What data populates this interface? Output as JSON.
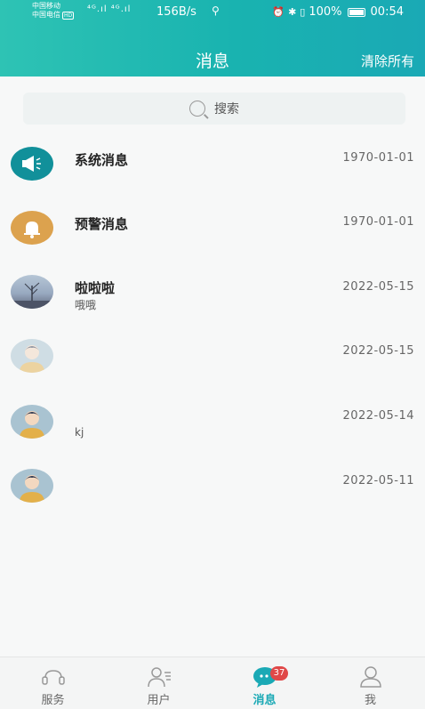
{
  "status_bar": {
    "carrier_1": "中国移动",
    "carrier_2": "中国电信",
    "hd": "HD",
    "signals": "⁴ᴳ.ıl ⁴ᴳ.ıl",
    "net_speed": "156B/s",
    "battery": "100%",
    "time": "00:54"
  },
  "header": {
    "title": "消息",
    "clear_all": "清除所有"
  },
  "search": {
    "placeholder": "搜索"
  },
  "messages": [
    {
      "name": "系统消息",
      "subtitle": "",
      "date": "1970-01-01",
      "avatar": "megaphone-icon"
    },
    {
      "name": "预警消息",
      "subtitle": "",
      "date": "1970-01-01",
      "avatar": "bell-icon"
    },
    {
      "name": "啦啦啦",
      "subtitle": "哦哦",
      "date": "2022-05-15",
      "avatar": "photo"
    },
    {
      "name": "",
      "subtitle": "",
      "date": "2022-05-15",
      "avatar": "default-user"
    },
    {
      "name": "",
      "subtitle": "kj",
      "date": "2022-05-14",
      "avatar": "default-user"
    },
    {
      "name": "",
      "subtitle": "",
      "date": "2022-05-11",
      "avatar": "default-user"
    }
  ],
  "bottom_nav": {
    "items": [
      {
        "label": "服务",
        "icon": "service-icon",
        "active": false
      },
      {
        "label": "用户",
        "icon": "users-icon",
        "active": false
      },
      {
        "label": "消息",
        "icon": "chat-icon",
        "active": true,
        "badge": "37"
      },
      {
        "label": "我",
        "icon": "profile-icon",
        "active": false
      }
    ]
  },
  "colors": {
    "header_start": "#2ec3b4",
    "header_end": "#1aa9b5",
    "accent": "#1aa9b5",
    "system_avatar": "#11909a",
    "warning_avatar": "#dca24e",
    "badge": "#e04848"
  }
}
